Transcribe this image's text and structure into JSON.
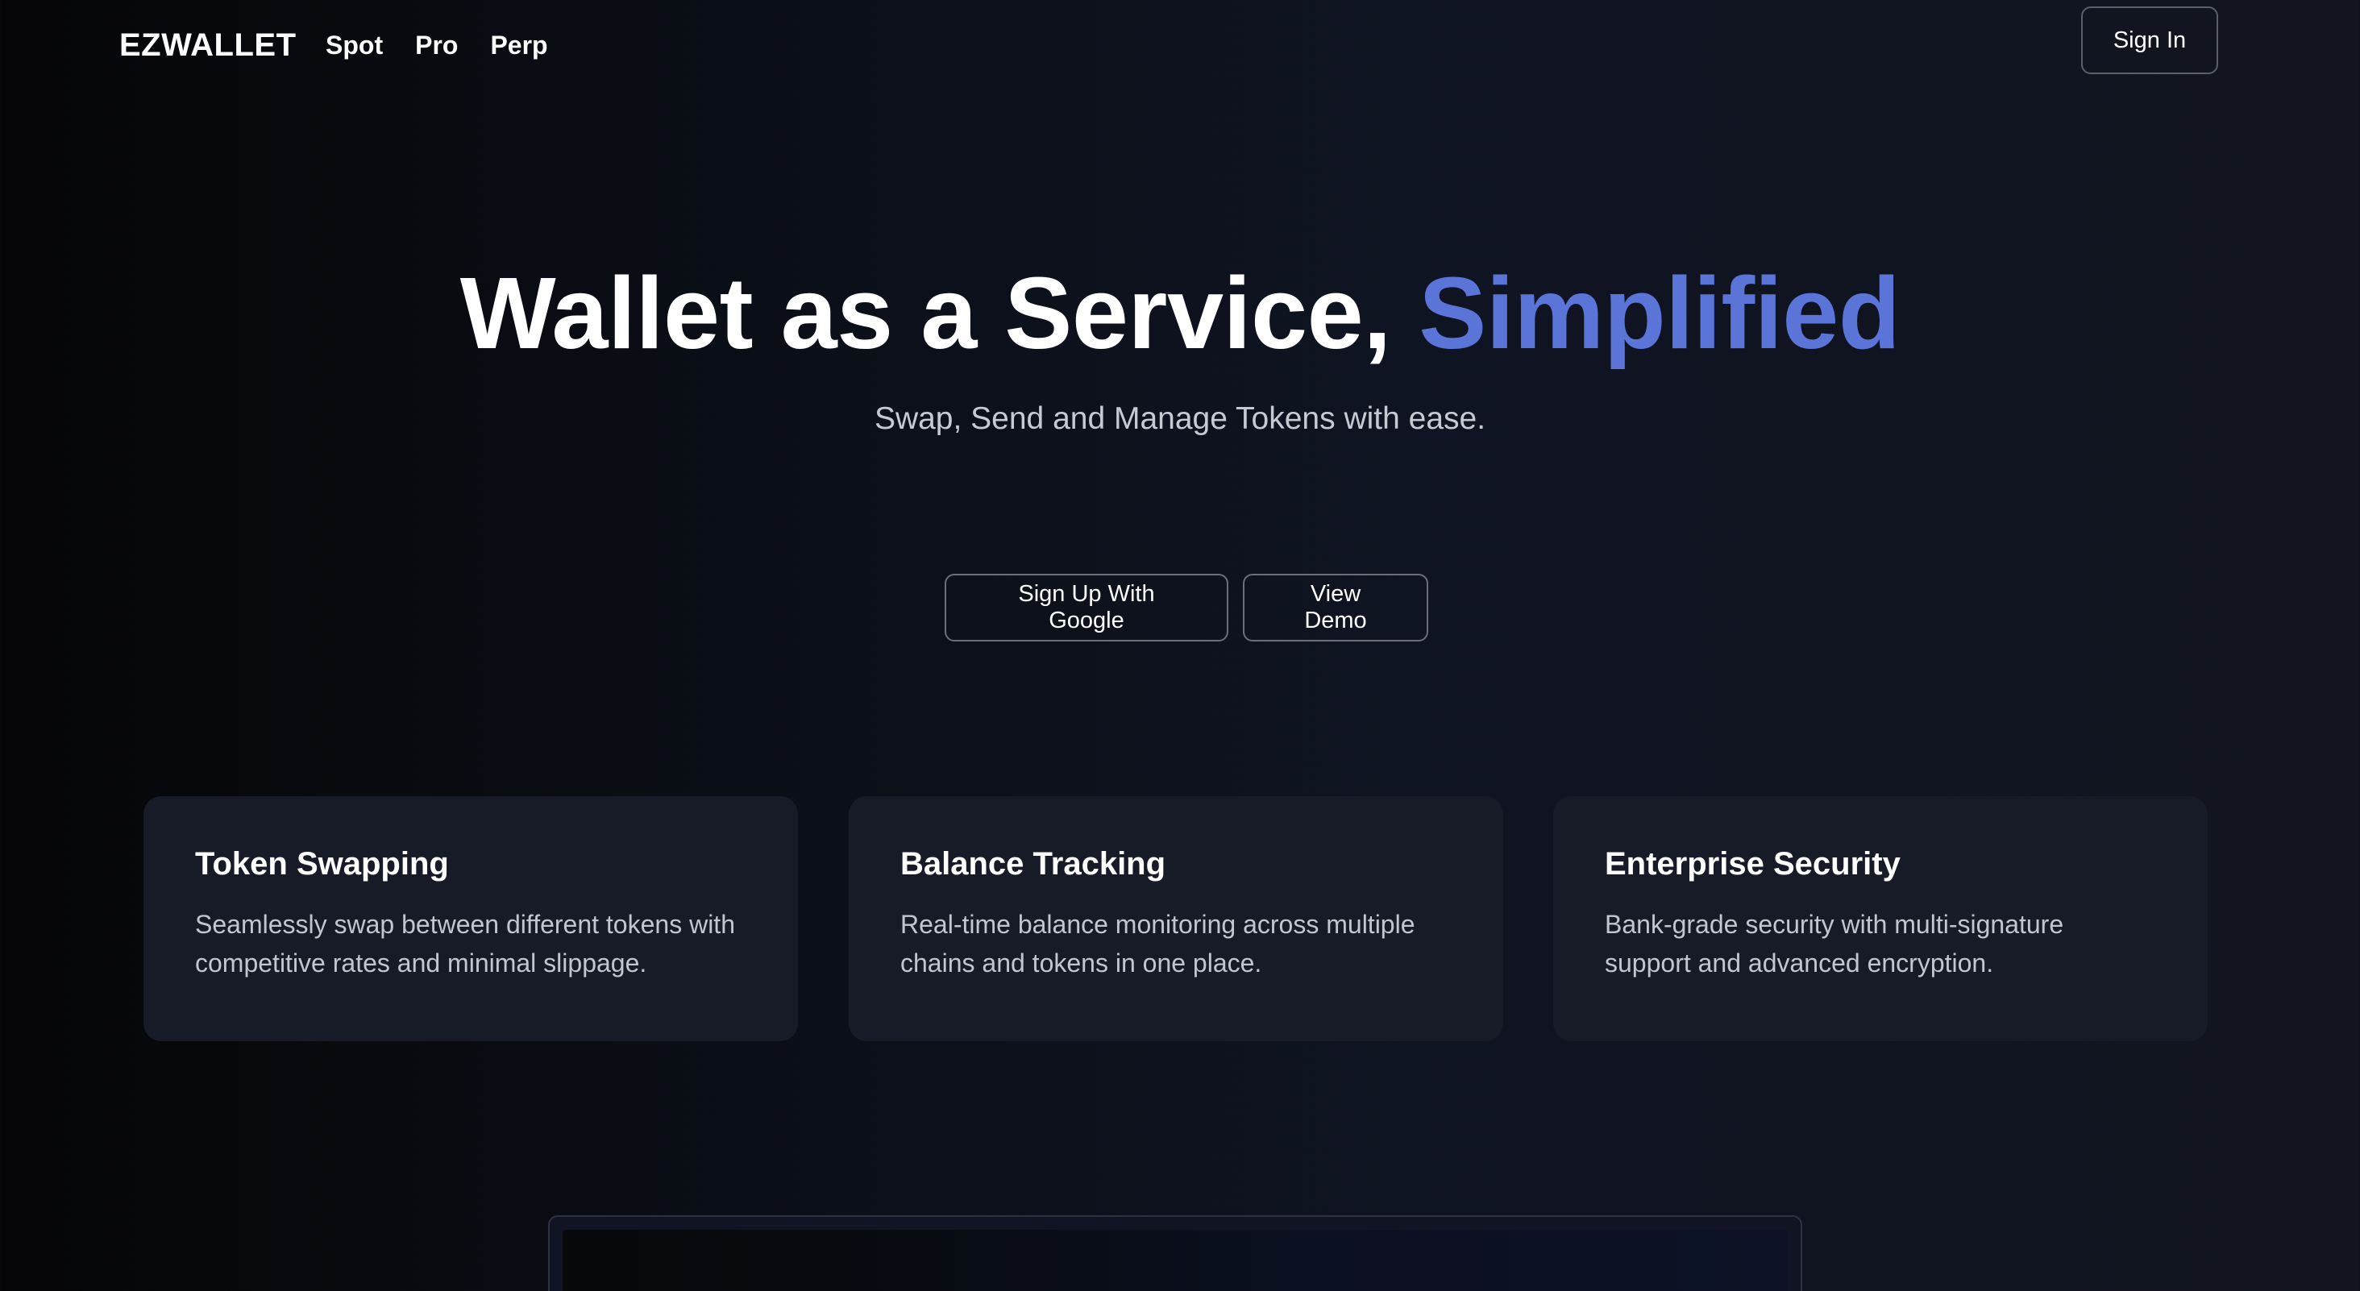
{
  "header": {
    "brand": "EZWALLET",
    "nav": [
      "Spot",
      "Pro",
      "Perp"
    ],
    "sign_in": "Sign In"
  },
  "hero": {
    "title_main": "Wallet as a Service,",
    "title_accent": "Simplified",
    "subtitle": "Swap, Send and Manage Tokens with ease.",
    "cta_google": "Sign Up With Google",
    "cta_demo": "View Demo"
  },
  "features": [
    {
      "title": "Token Swapping",
      "desc": "Seamlessly swap between different tokens with competitive rates and minimal slippage."
    },
    {
      "title": "Balance Tracking",
      "desc": "Real-time balance monitoring across multiple chains and tokens in one place."
    },
    {
      "title": "Enterprise Security",
      "desc": "Bank-grade security with multi-signature support and advanced encryption."
    }
  ],
  "colors": {
    "accent": "#5b74d8",
    "background": "#0b0f18",
    "card": "#171b27"
  }
}
